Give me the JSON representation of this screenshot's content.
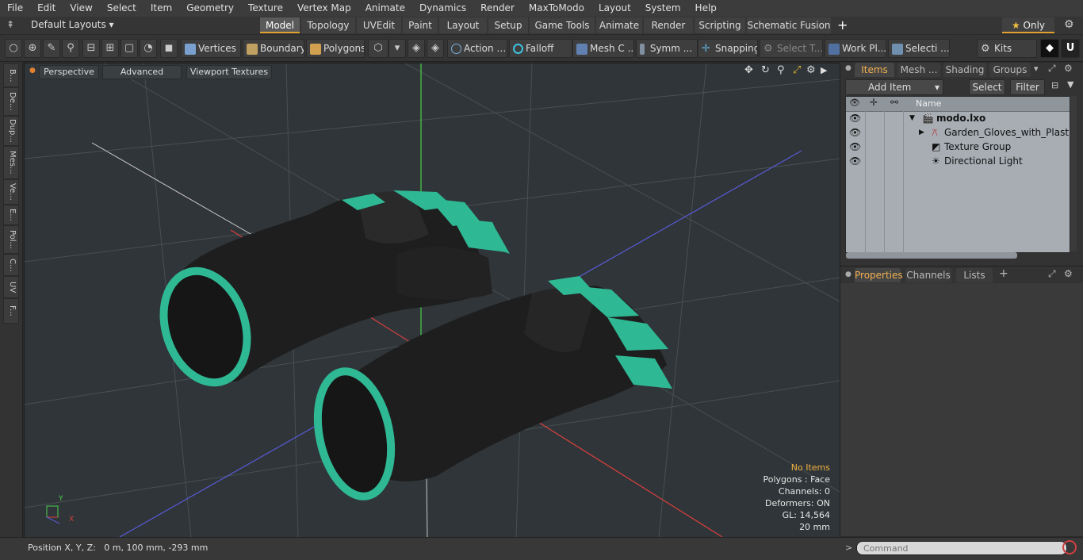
{
  "menu": [
    "File",
    "Edit",
    "View",
    "Select",
    "Item",
    "Geometry",
    "Texture",
    "Vertex Map",
    "Animate",
    "Dynamics",
    "Render",
    "MaxToModo",
    "Layout",
    "System",
    "Help"
  ],
  "layout_selector": "Default Layouts",
  "mode_tabs": [
    "Model",
    "Topology",
    "UVEdit",
    "Paint",
    "Layout",
    "Setup",
    "Game Tools",
    "Animate",
    "Render",
    "Scripting",
    "Schematic Fusion"
  ],
  "add_tab": "+",
  "only_label": "Only",
  "toolbar": {
    "vertices": "Vertices",
    "boundary": "Boundary",
    "polygons": "Polygons",
    "action": "Action",
    "falloff": "Falloff",
    "mesh_c": "Mesh C ...",
    "symm": "Symm ...",
    "snapping": "Snapping",
    "select_t": "Select T...",
    "work_pl": "Work Pl...",
    "selecti": "Selecti ...",
    "kits": "Kits"
  },
  "left_tabs": [
    "B...",
    "De...",
    "Dup...",
    "Mes...",
    "Ve...",
    "E...",
    "Pol...",
    "C...",
    "UV",
    "F..."
  ],
  "viewport": {
    "perspective": "Perspective",
    "advanced": "Advanced",
    "textures": "Viewport Textures",
    "info": [
      "No Items",
      "Polygons : Face",
      "Channels: 0",
      "Deformers: ON",
      "GL: 14,564",
      "20 mm"
    ],
    "axis_y": "Y",
    "axis_x": "X"
  },
  "items_panel": {
    "tabs": [
      "Items",
      "Mesh ...",
      "Shading",
      "Groups"
    ],
    "add_item": "Add Item",
    "select": "Select",
    "filter": "Filter",
    "name_header": "Name",
    "rows": [
      "modo.lxo",
      "Garden_Gloves_with_Plastic_...",
      "Texture Group",
      "Directional Light"
    ]
  },
  "props_panel": {
    "tabs": [
      "Properties",
      "Channels",
      "Lists"
    ],
    "add": "+"
  },
  "status": {
    "position": "Position X, Y, Z:   0 m, 100 mm, -293 mm",
    "command_placeholder": "Command"
  },
  "colors": {
    "accent": "#f0b050",
    "glove_trim": "#2fb894",
    "glove_body": "#1e1e1e",
    "grid": "#4a5256"
  }
}
